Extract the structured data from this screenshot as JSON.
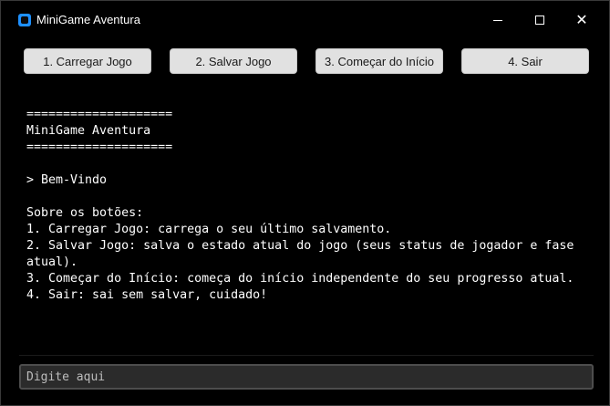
{
  "window": {
    "title": "MiniGame Aventura",
    "accent": "#1e90ff"
  },
  "toolbar": {
    "buttons": [
      {
        "label": "1. Carregar Jogo"
      },
      {
        "label": "2. Salvar Jogo"
      },
      {
        "label": "3. Começar do Início"
      },
      {
        "label": "4. Sair"
      }
    ]
  },
  "output": {
    "lines": [
      "====================",
      "MiniGame Aventura",
      "====================",
      "",
      "> Bem-Vindo",
      "",
      "Sobre os botões:",
      "1. Carregar Jogo: carrega o seu último salvamento.",
      "2. Salvar Jogo: salva o estado atual do jogo (seus status de jogador e fase",
      "atual).",
      "3. Começar do Início: começa do início independente do seu progresso atual.",
      "4. Sair: sai sem salvar, cuidado!"
    ]
  },
  "input": {
    "placeholder": "Digite aqui",
    "value": ""
  }
}
